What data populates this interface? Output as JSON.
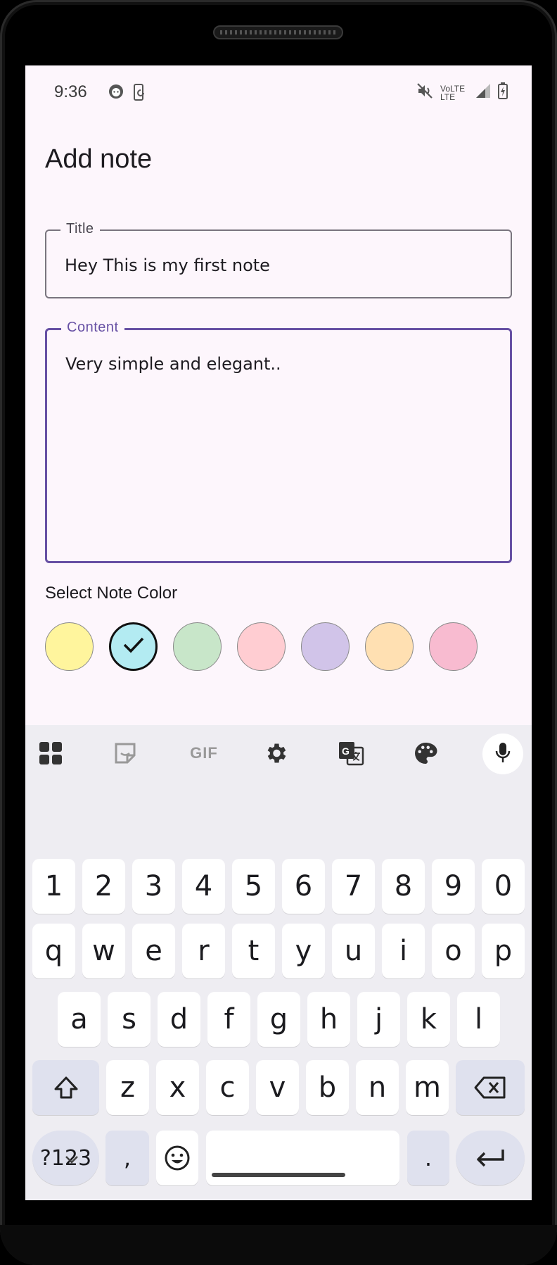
{
  "status_bar": {
    "time": "9:36",
    "network_label_1": "Vo",
    "network_label_2": "LTE",
    "network_label_3": "LTE"
  },
  "page": {
    "title": "Add note"
  },
  "form": {
    "title_label": "Title",
    "title_value": "Hey This is my first note",
    "content_label": "Content",
    "content_value": "Very simple and elegant..",
    "color_label": "Select Note Color",
    "colors": [
      {
        "hex": "#fff59d",
        "selected": false
      },
      {
        "hex": "#b3ebf2",
        "selected": true
      },
      {
        "hex": "#c8e6c9",
        "selected": false
      },
      {
        "hex": "#ffcdd2",
        "selected": false
      },
      {
        "hex": "#d1c4e9",
        "selected": false
      },
      {
        "hex": "#ffe0b2",
        "selected": false
      },
      {
        "hex": "#f8bbd0",
        "selected": false
      }
    ]
  },
  "keyboard": {
    "toolbar_gif": "GIF",
    "row_numbers": [
      "1",
      "2",
      "3",
      "4",
      "5",
      "6",
      "7",
      "8",
      "9",
      "0"
    ],
    "row_top": [
      "q",
      "w",
      "e",
      "r",
      "t",
      "y",
      "u",
      "i",
      "o",
      "p"
    ],
    "row_middle": [
      "a",
      "s",
      "d",
      "f",
      "g",
      "h",
      "j",
      "k",
      "l"
    ],
    "row_bottom": [
      "z",
      "x",
      "c",
      "v",
      "b",
      "n",
      "m"
    ],
    "symbols_key": "?123",
    "comma_key": ",",
    "period_key": "."
  }
}
